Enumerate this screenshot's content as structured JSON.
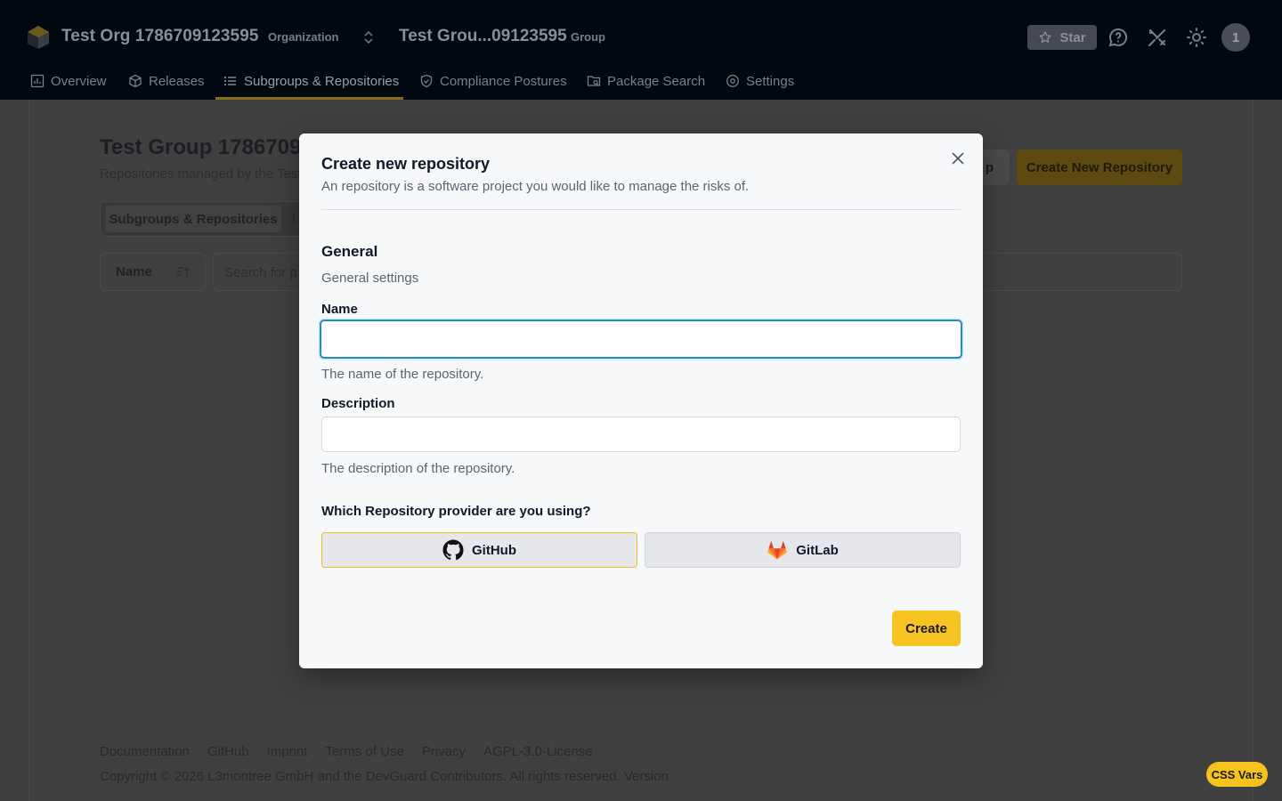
{
  "header": {
    "org_name": "Test Org 1786709123595",
    "org_badge": "Organization",
    "group_name": "Test Grou...09123595",
    "group_badge": "Group",
    "star_label": "Star",
    "avatar_initial": "1",
    "icons": [
      "app-logo-icon",
      "chevron-up-down-icon",
      "star-icon",
      "help-chat-icon",
      "tools-icon",
      "sun-icon"
    ]
  },
  "nav": {
    "items": [
      {
        "label": "Overview",
        "icon": "chart-icon"
      },
      {
        "label": "Releases",
        "icon": "package-icon"
      },
      {
        "label": "Subgroups & Repositories",
        "icon": "list-icon",
        "active": true
      },
      {
        "label": "Compliance Postures",
        "icon": "shield-icon"
      },
      {
        "label": "Package Search",
        "icon": "folder-search-icon"
      },
      {
        "label": "Settings",
        "icon": "gear-icon"
      }
    ]
  },
  "page": {
    "title": "Test Group 1786709",
    "subtitle": "Repositories managed by the Test",
    "subgroup_button": "p",
    "create_repo_button": "Create New Repository",
    "tabs": [
      "Subgroups & Repositories",
      "I"
    ],
    "sort_label": "Name",
    "search_placeholder": "Search for p"
  },
  "footer": {
    "links": [
      "Documentation",
      "GitHub",
      "Imprint",
      "Terms of Use",
      "Privacy",
      "AGPL-3.0-License"
    ],
    "copyright": "Copyright © 2026 L3montree GmbH and the DevGuard Contributors. All rights reserved. Version"
  },
  "css_vars_label": "CSS Vars",
  "modal": {
    "title": "Create new repository",
    "description": "An repository is a software project you would like to manage the risks of.",
    "section_title": "General",
    "section_desc": "General settings",
    "name_label": "Name",
    "name_value": "",
    "name_help": "The name of the repository.",
    "description_label": "Description",
    "description_value": "",
    "description_help": "The description of the repository.",
    "provider_question": "Which Repository provider are you using?",
    "providers": [
      {
        "label": "GitHub",
        "icon": "github-icon",
        "selected": true
      },
      {
        "label": "GitLab",
        "icon": "gitlab-icon",
        "selected": false
      }
    ],
    "create_label": "Create",
    "close_icon": "close-icon"
  },
  "colors": {
    "accent": "#f7c322",
    "focus_ring": "#1f8fb3",
    "header_bg": "#02080f"
  }
}
